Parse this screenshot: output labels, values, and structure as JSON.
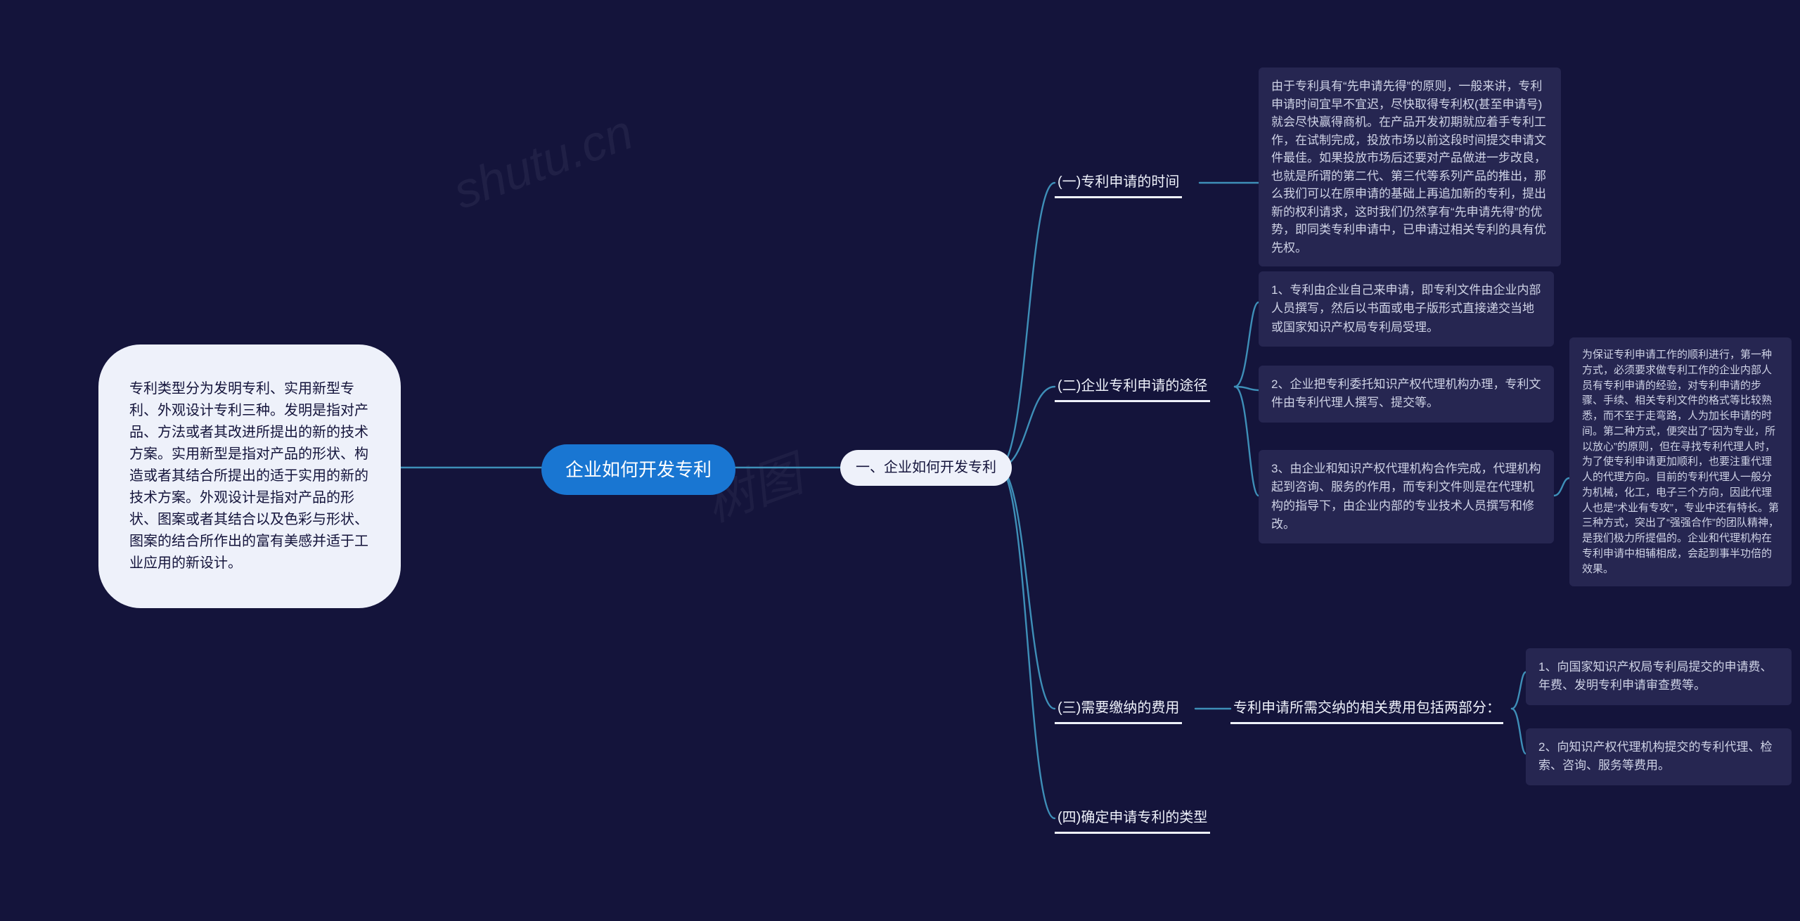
{
  "root": "企业如何开发专利",
  "left_summary": "专利类型分为发明专利、实用新型专利、外观设计专利三种。发明是指对产品、方法或者其改进所提出的新的技术方案。实用新型是指对产品的形状、构造或者其结合所提出的适于实用的新的技术方案。外观设计是指对产品的形状、图案或者其结合以及色彩与形状、图案的结合所作出的富有美感并适于工业应用的新设计。",
  "level1": "一、企业如何开发专利",
  "sec1": {
    "title": "(一)专利申请的时间",
    "detail": "由于专利具有“先申请先得”的原则，一般来讲，专利申请时间宜早不宜迟，尽快取得专利权(甚至申请号)就会尽快赢得商机。在产品开发初期就应着手专利工作，在试制完成，投放市场以前这段时间提交申请文件最佳。如果投放市场后还要对产品做进一步改良，也就是所谓的第二代、第三代等系列产品的推出，那么我们可以在原申请的基础上再追加新的专利，提出新的权利请求，这时我们仍然享有“先申请先得”的优势，即同类专利申请中，已申请过相关专利的具有优先权。"
  },
  "sec2": {
    "title": "(二)企业专利申请的途径",
    "p1": "1、专利由企业自己来申请，即专利文件由企业内部人员撰写，然后以书面或电子版形式直接递交当地或国家知识产权局专利局受理。",
    "p2": "2、企业把专利委托知识产权代理机构办理，专利文件由专利代理人撰写、提交等。",
    "p3": "3、由企业和知识产权代理机构合作完成，代理机构起到咨询、服务的作用，而专利文件则是在代理机构的指导下，由企业内部的专业技术人员撰写和修改。",
    "p3_detail": "为保证专利申请工作的顺利进行，第一种方式，必须要求做专利工作的企业内部人员有专利申请的经验，对专利申请的步骤、手续、相关专利文件的格式等比较熟悉，而不至于走弯路，人为加长申请的时间。第二种方式，便突出了“因为专业，所以放心”的原则，但在寻找专利代理人时，为了使专利申请更加顺利，也要注重代理人的代理方向。目前的专利代理人一般分为机械，化工，电子三个方向，因此代理人也是“术业有专攻”，专业中还有特长。第三种方式，突出了“强强合作”的团队精神，是我们极力所提倡的。企业和代理机构在专利申请中相辅相成，会起到事半功倍的效果。"
  },
  "sec3": {
    "title": "(三)需要缴纳的费用",
    "sub": "专利申请所需交纳的相关费用包括两部分：",
    "f1": "1、向国家知识产权局专利局提交的申请费、年费、发明专利申请审查费等。",
    "f2": "2、向知识产权代理机构提交的专利代理、检索、咨询、服务等费用。"
  },
  "sec4": {
    "title": "(四)确定申请专利的类型"
  },
  "watermark": "shutu.cn"
}
